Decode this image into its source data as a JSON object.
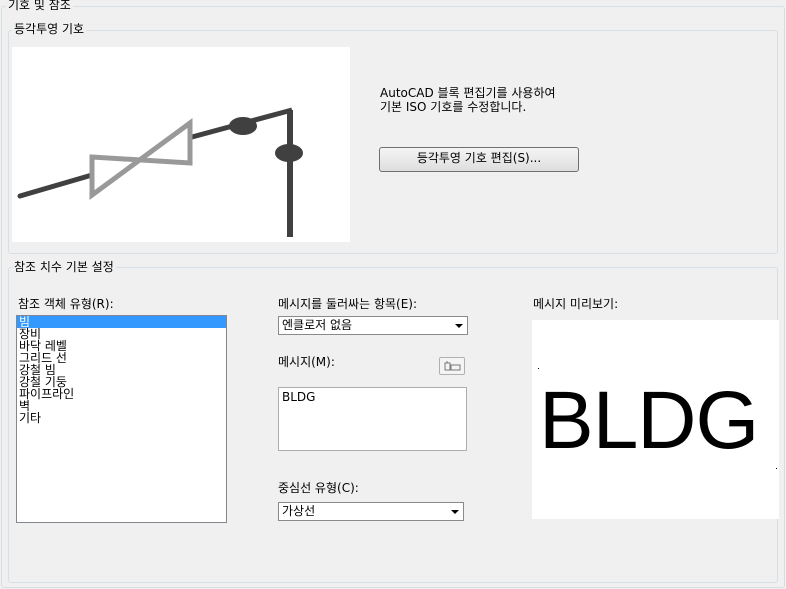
{
  "window": {
    "title": "기호 및 참조"
  },
  "iso_group": {
    "title": "등각투영 기호",
    "description_line1": "AutoCAD 블록 편집기를 사용하여",
    "description_line2": "기본 ISO 기호를 수정합니다.",
    "edit_button": "등각투영 기호 편집(S)..."
  },
  "ref_group": {
    "title": "참조 치수 기본 설정",
    "object_type_label": "참조 객체 유형(R):",
    "object_types": [
      "빔",
      "장비",
      "바닥 레벨",
      "그리드 선",
      "강철 빔",
      "강철 기둥",
      "파이프라인",
      "벽",
      "기타"
    ],
    "selected_index": 0,
    "enclosure_label": "메시지를 둘러싸는 항목(E):",
    "enclosure_value": "엔클로저 없음",
    "message_label": "메시지(M):",
    "message_value": "BLDG",
    "centerline_label": "중심선 유형(C):",
    "centerline_value": "가상선",
    "preview_label": "메시지 미리보기:",
    "preview_text": "BLDG"
  },
  "icons": {
    "insert_field": "insert-field-icon"
  },
  "colors": {
    "selection": "#3399ff",
    "background": "#f0f0f0",
    "pipe_dark": "#404040",
    "valve_gray": "#999999"
  }
}
